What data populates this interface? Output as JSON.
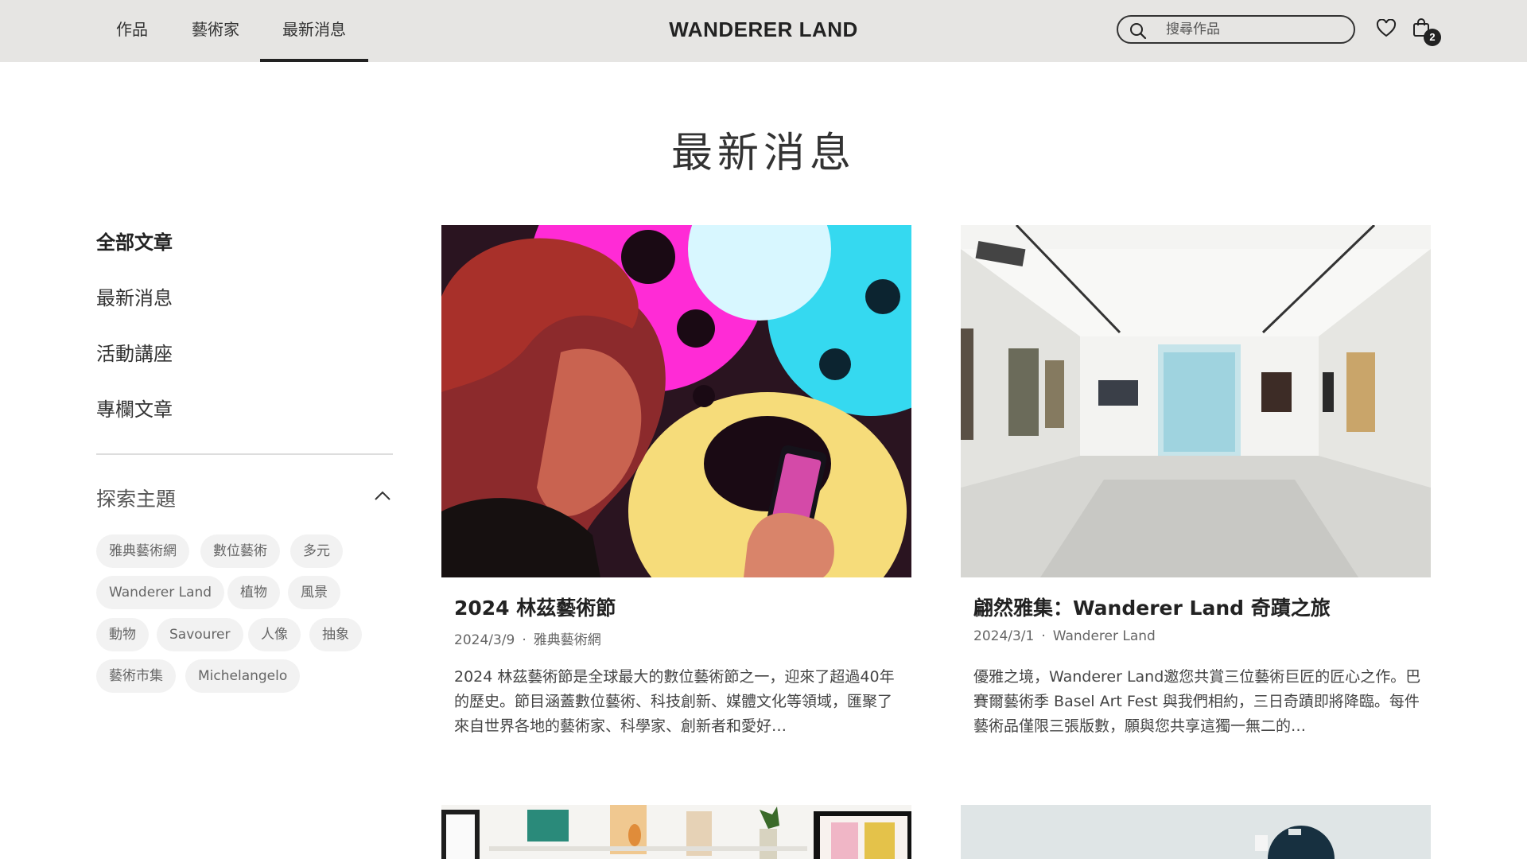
{
  "nav": {
    "items": [
      "作品",
      "藝術家",
      "最新消息"
    ],
    "active_index": 2,
    "logo": "WANDERER LAND",
    "search_placeholder": "搜尋作品",
    "cart_count": "2"
  },
  "page": {
    "title": "最新消息"
  },
  "sidebar": {
    "categories": [
      "全部文章",
      "最新消息",
      "活動講座",
      "專欄文章"
    ],
    "active_index": 0,
    "explore_label": "探索主題",
    "tags": [
      "雅典藝術網",
      "數位藝術",
      "多元",
      "Wanderer Land",
      "植物",
      "風景",
      "動物",
      "Savourer",
      "人像",
      "抽象",
      "藝術市集",
      "Michelangelo"
    ]
  },
  "articles": [
    {
      "title": "2024 林茲藝術節",
      "date": "2024/3/9",
      "source": "雅典藝術網",
      "excerpt": "2024 林茲藝術節是全球最大的數位藝術節之一，迎來了超過40年的歷史。節目涵蓋數位藝術、科技創新、媒體文化等領域，匯聚了來自世界各地的藝術家、科學家、創新者和愛好…"
    },
    {
      "title": "翩然雅集：Wanderer Land 奇蹟之旅",
      "date": "2024/3/1",
      "source": "Wanderer Land",
      "excerpt": "優雅之境，Wanderer Land邀您共賞三位藝術巨匠的匠心之作。巴賽爾藝術季 Basel Art Fest 與我們相約，三日奇蹟即將降臨。每件藝術品僅限三張版數，願與您共享這獨一無二的…"
    }
  ]
}
